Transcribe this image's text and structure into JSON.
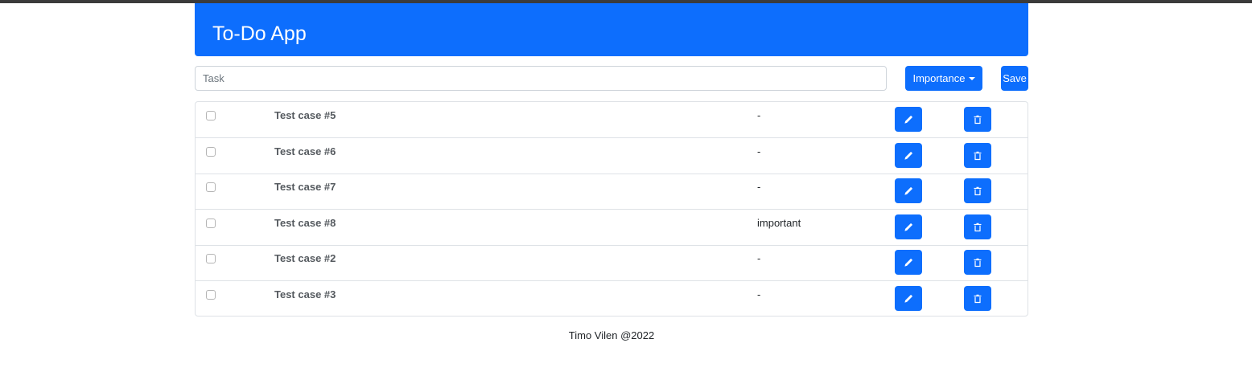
{
  "app": {
    "title": "To-Do App"
  },
  "form": {
    "task_placeholder": "Task",
    "task_value": "",
    "importance_label": "Importance",
    "save_label": "Save"
  },
  "tasks": [
    {
      "name": "Test case #5",
      "importance": "-"
    },
    {
      "name": "Test case #6",
      "importance": "-"
    },
    {
      "name": "Test case #7",
      "importance": "-"
    },
    {
      "name": "Test case #8",
      "importance": "important"
    },
    {
      "name": "Test case #2",
      "importance": "-"
    },
    {
      "name": "Test case #3",
      "importance": "-"
    }
  ],
  "footer": {
    "text": "Timo Vilen @2022"
  },
  "colors": {
    "primary": "#0d6efd",
    "border": "#dee2e6"
  },
  "icons": {
    "edit": "pencil-icon",
    "delete": "trash-icon"
  }
}
